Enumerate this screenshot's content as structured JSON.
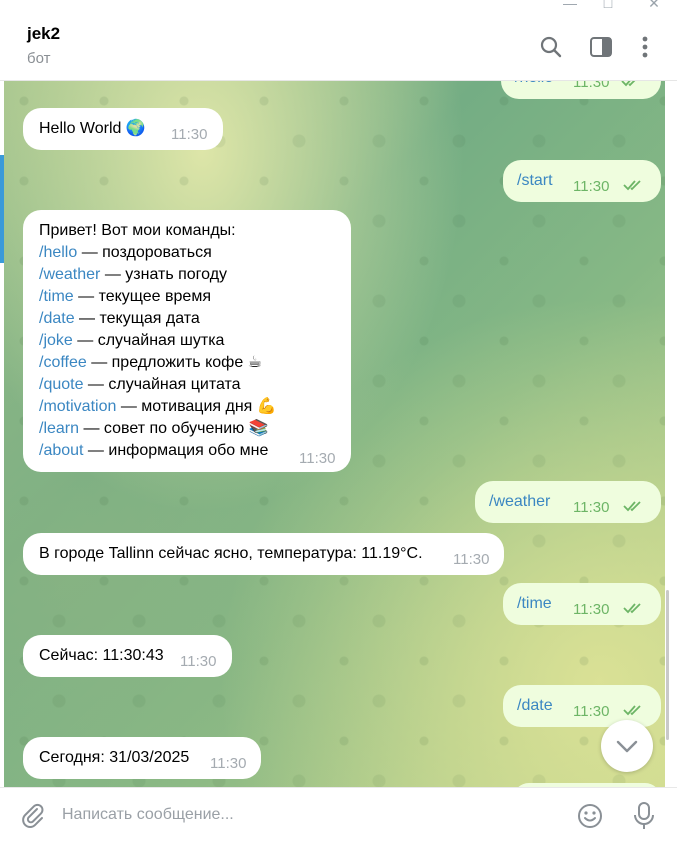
{
  "header": {
    "title": "jek2",
    "status": "бот",
    "icons": [
      "search-icon",
      "sidebar-toggle-icon",
      "more-vertical-icon"
    ]
  },
  "window_controls": [
    "minimize-icon",
    "maximize-icon",
    "close-icon"
  ],
  "messages": [
    {
      "dir": "out",
      "text": "/hello",
      "time": "11:30"
    },
    {
      "dir": "in",
      "text": "Hello World 🌍",
      "time": "11:30"
    },
    {
      "dir": "out",
      "text": "/start",
      "time": "11:30"
    },
    {
      "dir": "in",
      "intro": "Привет! Вот мои команды:",
      "time": "11:30",
      "commands": [
        {
          "cmd": "/hello",
          "desc": " — поздороваться"
        },
        {
          "cmd": "/weather",
          "desc": " — узнать погоду"
        },
        {
          "cmd": "/time",
          "desc": " — текущее время"
        },
        {
          "cmd": "/date",
          "desc": " — текущая дата"
        },
        {
          "cmd": "/joke",
          "desc": " — случайная шутка"
        },
        {
          "cmd": "/coffee",
          "desc": " — предложить кофе ☕"
        },
        {
          "cmd": "/quote",
          "desc": " — случайная цитата"
        },
        {
          "cmd": "/motivation",
          "desc": " — мотивация дня 💪"
        },
        {
          "cmd": "/learn",
          "desc": " — совет по обучению 📚"
        },
        {
          "cmd": "/about",
          "desc": " — информация обо мне"
        }
      ]
    },
    {
      "dir": "out",
      "text": "/weather",
      "time": "11:30"
    },
    {
      "dir": "in",
      "text": "В городе Tallinn сейчас ясно, температура: 11.19°C.",
      "time": "11:30"
    },
    {
      "dir": "out",
      "text": "/time",
      "time": "11:30"
    },
    {
      "dir": "in",
      "text": "Сейчас: 11:30:43",
      "time": "11:30"
    },
    {
      "dir": "out",
      "text": "/date",
      "time": "11:30"
    },
    {
      "dir": "in",
      "text": "Сегодня: 31/03/2025",
      "time": "11:30"
    }
  ],
  "composer": {
    "placeholder": "Написать сообщение...",
    "value": ""
  },
  "colors": {
    "outgoing_bubble": "#effdde",
    "incoming_bubble": "#ffffff",
    "command_link": "#3b87c2",
    "read_checks": "#6db566"
  }
}
